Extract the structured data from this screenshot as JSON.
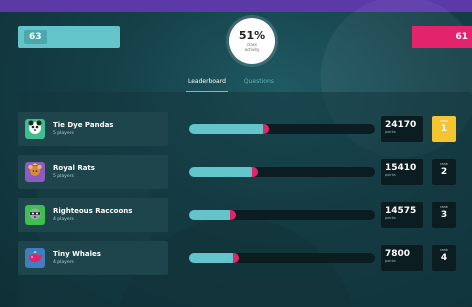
{
  "header": {
    "left_score": "63",
    "right_score": "61",
    "progress_percent": "51%",
    "progress_caption": "class\nactivity",
    "colors": {
      "top_bar": "#5b3aa8",
      "teal": "#63c5c9",
      "pink": "#e3236b",
      "gold": "#f4c531"
    }
  },
  "tabs": [
    {
      "label": "Leaderboard",
      "active": true
    },
    {
      "label": "Questions",
      "active": false
    }
  ],
  "teams": [
    {
      "name": "Tie Dye Pandas",
      "players": "5 players",
      "points": "24170",
      "points_label": "points",
      "rank_label": "rank",
      "rank": "1",
      "progress": 0.42,
      "avatar_icon": "panda-icon",
      "avatar_color": "#3fbf8f"
    },
    {
      "name": "Royal Rats",
      "players": "5 players",
      "points": "15410",
      "points_label": "points",
      "rank_label": "rank",
      "rank": "2",
      "progress": 0.36,
      "avatar_icon": "rat-icon",
      "avatar_color": "#8b5bbf"
    },
    {
      "name": "Righteous Raccoons",
      "players": "4 players",
      "points": "14575",
      "points_label": "points",
      "rank_label": "rank",
      "rank": "3",
      "progress": 0.24,
      "avatar_icon": "raccoon-icon",
      "avatar_color": "#3fbf4f"
    },
    {
      "name": "Tiny Whales",
      "players": "4 players",
      "points": "7800",
      "points_label": "points",
      "rank_label": "rank",
      "rank": "4",
      "progress": 0.26,
      "avatar_icon": "whale-icon",
      "avatar_color": "#3f7fbf"
    }
  ]
}
